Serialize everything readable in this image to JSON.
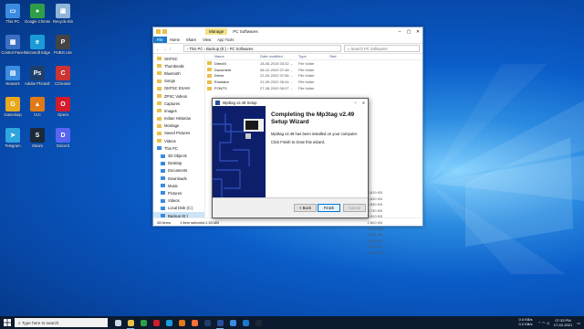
{
  "desktop": {
    "icons": [
      {
        "label": "This PC",
        "color": "#3b8be0",
        "glyph": "▭"
      },
      {
        "label": "Google Chrome",
        "color": "#2f9e49",
        "glyph": "●"
      },
      {
        "label": "Recycle Bin",
        "color": "#8fb5d8",
        "glyph": "▣"
      },
      {
        "label": "Control Panel",
        "color": "#3b6fc4",
        "glyph": "▦"
      },
      {
        "label": "Microsoft Edge",
        "color": "#1a9bd7",
        "glyph": "e"
      },
      {
        "label": "PUBG Lite",
        "color": "#444",
        "glyph": "P"
      },
      {
        "label": "Network",
        "color": "#3b8be0",
        "glyph": "▤"
      },
      {
        "label": "Adobe Photoshop",
        "color": "#1f3f6b",
        "glyph": "Ps"
      },
      {
        "label": "CCleaner",
        "color": "#cc3333",
        "glyph": "C"
      },
      {
        "label": "Gameloop",
        "color": "#e8a81e",
        "glyph": "G"
      },
      {
        "label": "VLC",
        "color": "#e07a16",
        "glyph": "▲"
      },
      {
        "label": "Opera",
        "color": "#d21b2b",
        "glyph": "O"
      },
      {
        "label": "Telegram",
        "color": "#2ea5df",
        "glyph": "➤"
      },
      {
        "label": "Steam",
        "color": "#1b2838",
        "glyph": "S"
      },
      {
        "label": "Discord",
        "color": "#5865f2",
        "glyph": "D"
      }
    ]
  },
  "explorer": {
    "manage_label": "Manage",
    "title": "PC Softwares",
    "ribbon": {
      "file": "File",
      "home": "Home",
      "share": "Share",
      "view": "View",
      "app_tools": "App Tools"
    },
    "nav": {
      "back": "←",
      "forward": "→",
      "up": "↑"
    },
    "address": "› This PC › Backup (E:) › PC Softwares",
    "search_placeholder": "Search PC Softwares",
    "sidebar": [
      {
        "label": "GKPSC",
        "type": "folder"
      },
      {
        "label": "Thumbnails",
        "type": "folder"
      },
      {
        "label": "Bluetooth",
        "type": "folder"
      },
      {
        "label": "Songs",
        "type": "folder"
      },
      {
        "label": "GKPSC EXAM",
        "type": "folder"
      },
      {
        "label": "ZPSC Videos",
        "type": "folder"
      },
      {
        "label": "Captures",
        "type": "folder"
      },
      {
        "label": "Images",
        "type": "folder"
      },
      {
        "label": "Indian Historian",
        "type": "folder"
      },
      {
        "label": "Montage",
        "type": "folder"
      },
      {
        "label": "Saved Pictures",
        "type": "folder"
      },
      {
        "label": "Videos",
        "type": "folder"
      },
      {
        "label": "This PC",
        "type": "pc"
      },
      {
        "label": "3D Objects",
        "type": "pc"
      },
      {
        "label": "Desktop",
        "type": "pc"
      },
      {
        "label": "Documents",
        "type": "pc"
      },
      {
        "label": "Downloads",
        "type": "pc"
      },
      {
        "label": "Music",
        "type": "pc"
      },
      {
        "label": "Pictures",
        "type": "pc"
      },
      {
        "label": "Videos",
        "type": "pc"
      },
      {
        "label": "Local Disk (C:)",
        "type": "pc"
      },
      {
        "label": "Backup (E:)",
        "type": "pc",
        "selected": true
      }
    ],
    "columns": {
      "name": "Name",
      "date": "Date modified",
      "type": "Type",
      "size": "Size"
    },
    "files": [
      {
        "name": "DirectX",
        "date": "18-06-2018 03:32 ...",
        "type": "File folder"
      },
      {
        "name": "Document",
        "date": "08-10-2020 07:48 ...",
        "type": "File folder"
      },
      {
        "name": "Driver",
        "date": "22-09-2022 07:56 ...",
        "type": "File folder"
      },
      {
        "name": "Emulator",
        "date": "21-09-2022 05:44 ...",
        "type": "File folder"
      },
      {
        "name": "FONTS",
        "date": "27-08-2020 06:07 ...",
        "type": "File folder"
      }
    ],
    "sizes": [
      "2,819 KB",
      "2,830 KB",
      "2,830 KB",
      "2,730 KB",
      "2,810 KB",
      "2,800 KB",
      "2,819 KB",
      "2,801 KB",
      "2,839 KB",
      "2,823 KB",
      "2,819 KB"
    ],
    "status": {
      "items": "28 items",
      "selected": "1 item selected 2.53 MB"
    }
  },
  "dialog": {
    "title": "Mp3tag v2.49 Setup",
    "heading": "Completing the Mp3tag v2.49 Setup Wizard",
    "body1": "Mp3tag v2.49 has been installed on your computer.",
    "body2": "Click Finish to close this wizard.",
    "back": "< Back",
    "finish": "Finish",
    "cancel": "Cancel"
  },
  "taskbar": {
    "search_placeholder": "Type here to search",
    "net_up": "0.0 KB/s",
    "net_down": "0.2 KB/s",
    "time": "07:33 PM",
    "date": "17-02-2021",
    "apps": [
      {
        "name": "task-view",
        "color": "#cfd8e3"
      },
      {
        "name": "file-explorer",
        "color": "#e8c04a",
        "active": true
      },
      {
        "name": "chrome",
        "color": "#2f9e49"
      },
      {
        "name": "opera",
        "color": "#d21b2b"
      },
      {
        "name": "edge",
        "color": "#1a9bd7"
      },
      {
        "name": "vlc",
        "color": "#e07a16"
      },
      {
        "name": "firefox",
        "color": "#ff7139"
      },
      {
        "name": "photoshop",
        "color": "#1f3f6b"
      },
      {
        "name": "mp3tag",
        "color": "#2a4fa0",
        "active": true
      },
      {
        "name": "store",
        "color": "#3b8be0"
      },
      {
        "name": "mail",
        "color": "#1979ca"
      },
      {
        "name": "steam",
        "color": "#1b2838"
      }
    ]
  }
}
